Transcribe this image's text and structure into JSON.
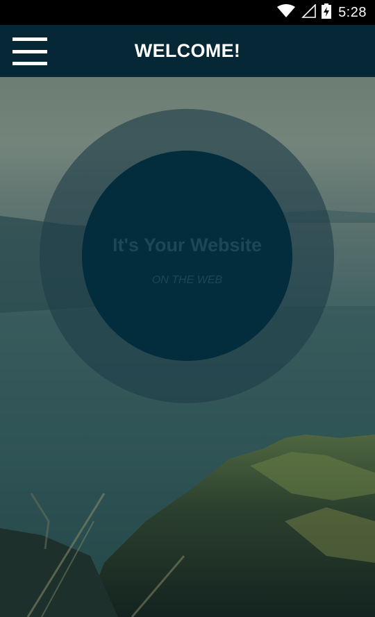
{
  "status_bar": {
    "time": "5:28",
    "icons": [
      "wifi-icon",
      "signal-icon",
      "battery-charging-icon"
    ]
  },
  "app_bar": {
    "title": "WELCOME!",
    "menu_icon": "hamburger-menu-icon",
    "background_color": "#062836"
  },
  "hero": {
    "title": "It's Your Website",
    "subtitle": "ON THE WEB",
    "inner_circle_color": "#032c3d"
  }
}
